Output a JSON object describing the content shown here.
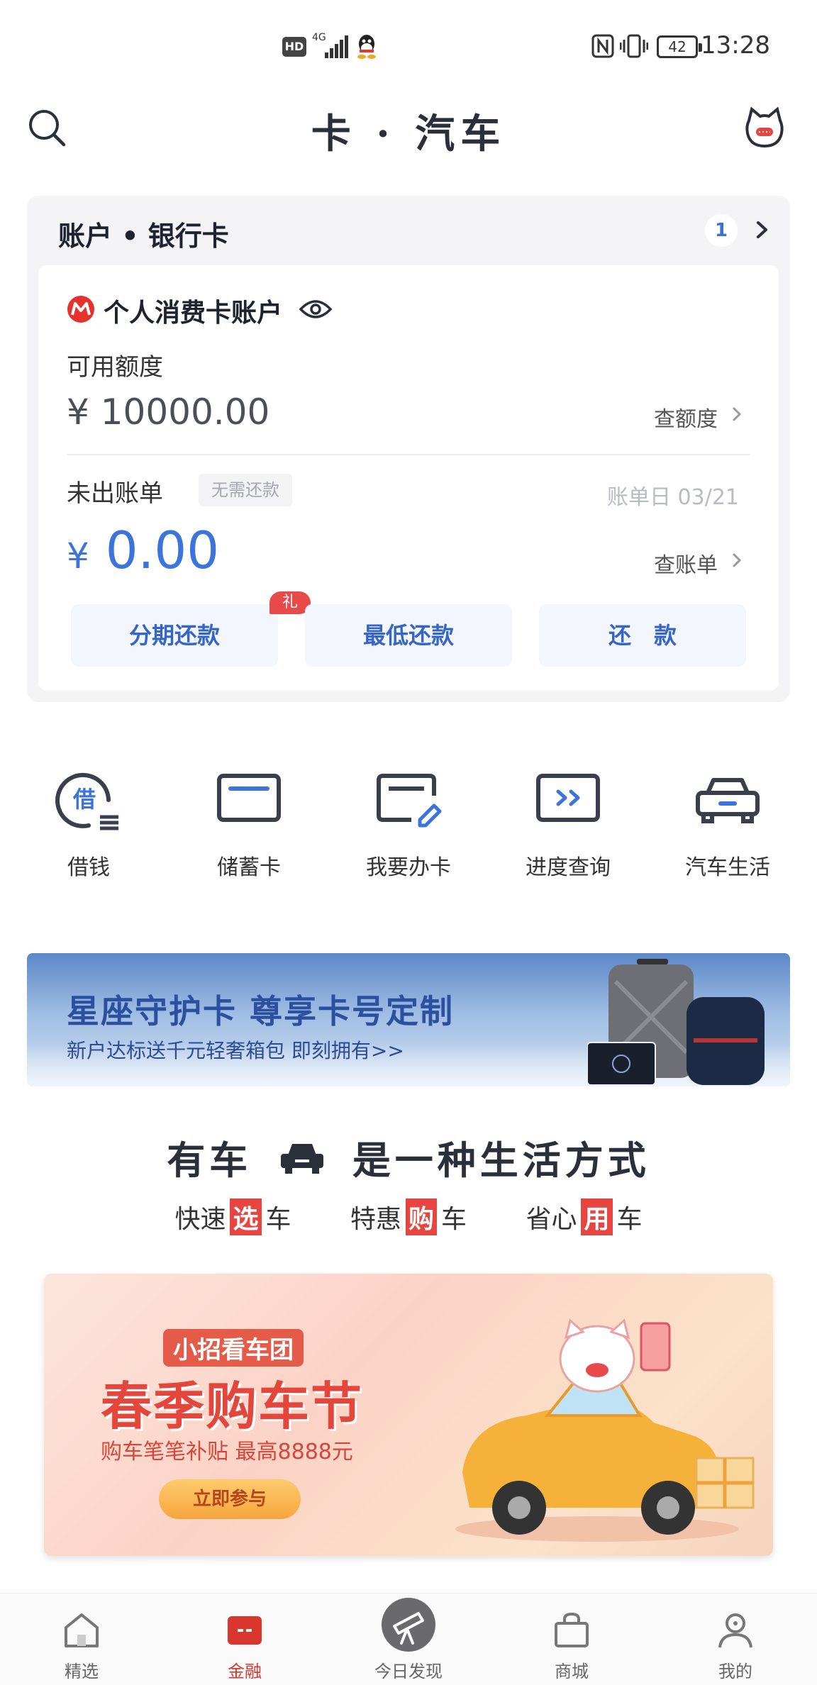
{
  "status_bar": {
    "time": "13:28",
    "battery": "42",
    "network_label": "HD",
    "network_type": "4G",
    "icons": [
      "hd-icon",
      "signal-icon",
      "qq-icon",
      "nfc-icon",
      "vibrate-icon",
      "battery-icon"
    ]
  },
  "header": {
    "title": "卡 · 汽车",
    "left_icon": "search-icon",
    "right_icon": "mascot-icon"
  },
  "account": {
    "section_title": "账户 • 银行卡",
    "badge_count": "1",
    "card_name": "个人消费卡账户",
    "available_label": "可用额度",
    "available_value": "¥ 10000.00",
    "check_limit_link": "查额度",
    "unbilled_label": "未出账单",
    "no_payment_tag": "无需还款",
    "bill_date": "账单日 03/21",
    "bill_currency": "¥",
    "bill_amount": "0.00",
    "check_bill_link": "查账单",
    "gift_tag": "礼",
    "buttons": [
      "分期还款",
      "最低还款",
      "还　款"
    ]
  },
  "quick_entries": [
    {
      "label": "借钱",
      "icon": "borrow-icon",
      "icon_text": "借"
    },
    {
      "label": "储蓄卡",
      "icon": "debit-card-icon"
    },
    {
      "label": "我要办卡",
      "icon": "apply-card-icon"
    },
    {
      "label": "进度查询",
      "icon": "progress-icon"
    },
    {
      "label": "汽车生活",
      "icon": "car-icon"
    }
  ],
  "banner": {
    "headline": "星座守护卡 尊享卡号定制",
    "subline": "新户达标送千元轻奢箱包 即刻拥有>>"
  },
  "car_section": {
    "slogan_left": "有车",
    "slogan_right": "是一种生活方式",
    "tags": [
      {
        "pre": "快速",
        "highlight": "选",
        "post": "车"
      },
      {
        "pre": "特惠",
        "highlight": "购",
        "post": "车"
      },
      {
        "pre": "省心",
        "highlight": "用",
        "post": "车"
      }
    ]
  },
  "promo": {
    "top_label": "小招看车团",
    "title": "春季购车节",
    "subtitle": "购车笔笔补贴 最高8888元",
    "cta": "立即参与"
  },
  "bottom_nav": [
    {
      "label": "精选",
      "icon": "home-icon",
      "active": false
    },
    {
      "label": "金融",
      "icon": "finance-icon",
      "active": true
    },
    {
      "label": "今日发现",
      "icon": "telescope-icon",
      "active": false
    },
    {
      "label": "商城",
      "icon": "shopping-bag-icon",
      "active": false
    },
    {
      "label": "我的",
      "icon": "profile-icon",
      "active": false
    }
  ],
  "colors": {
    "accent_blue": "#3c74dc",
    "brand_red": "#d9362e",
    "page_bg": "#ffffff",
    "card_bg": "#f4f4f6"
  }
}
